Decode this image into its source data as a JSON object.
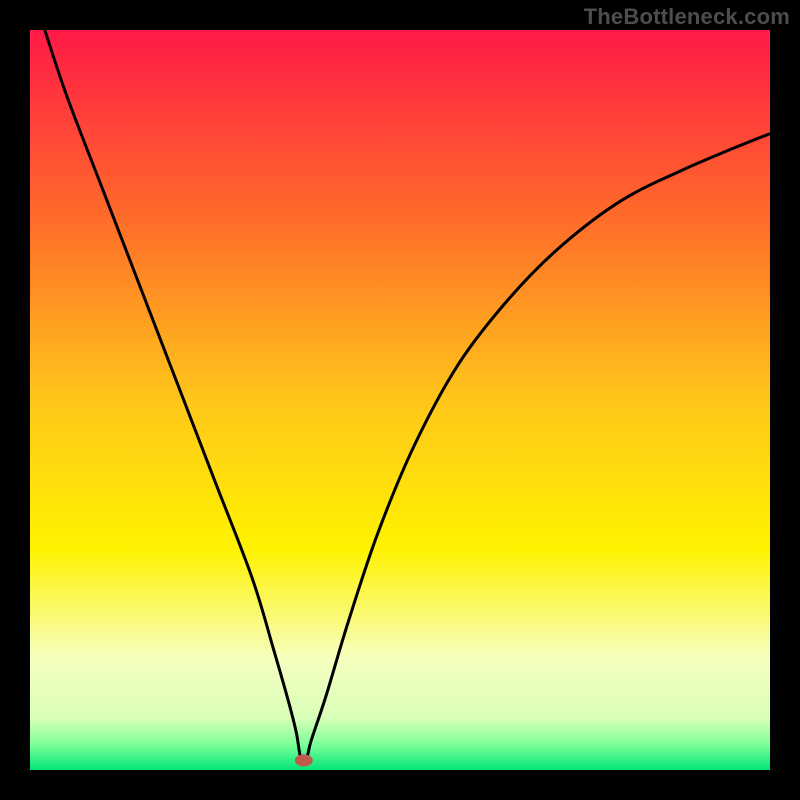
{
  "watermark": "TheBottleneck.com",
  "chart_data": {
    "type": "line",
    "title": "",
    "xlabel": "",
    "ylabel": "",
    "xlim": [
      0,
      100
    ],
    "ylim": [
      0,
      100
    ],
    "grid": false,
    "legend": false,
    "background_gradient": {
      "stops": [
        {
          "offset": 0.0,
          "color": "#ff1a47"
        },
        {
          "offset": 0.25,
          "color": "#ff6a2a"
        },
        {
          "offset": 0.5,
          "color": "#ffc61a"
        },
        {
          "offset": 0.7,
          "color": "#fff200"
        },
        {
          "offset": 0.85,
          "color": "#f6ffbf"
        },
        {
          "offset": 0.93,
          "color": "#d8ffb8"
        },
        {
          "offset": 0.965,
          "color": "#7fff9a"
        },
        {
          "offset": 1.0,
          "color": "#00e676"
        }
      ]
    },
    "series": [
      {
        "name": "bottleneck-curve",
        "color": "#000000",
        "x": [
          2,
          5,
          10,
          15,
          20,
          25,
          30,
          33,
          35,
          36,
          36.5,
          37,
          37.5,
          38,
          40,
          43,
          47,
          52,
          58,
          65,
          72,
          80,
          88,
          95,
          100
        ],
        "y": [
          100,
          91,
          78,
          65,
          52,
          39,
          26,
          16,
          9,
          5,
          2,
          1.5,
          2,
          4,
          10,
          20,
          32,
          44,
          55,
          64,
          71,
          77,
          81,
          84,
          86
        ]
      }
    ],
    "marker": {
      "name": "optimal-point",
      "x": 37,
      "y": 1.3,
      "color": "#c05a4d",
      "rx": 9,
      "ry": 6
    }
  }
}
